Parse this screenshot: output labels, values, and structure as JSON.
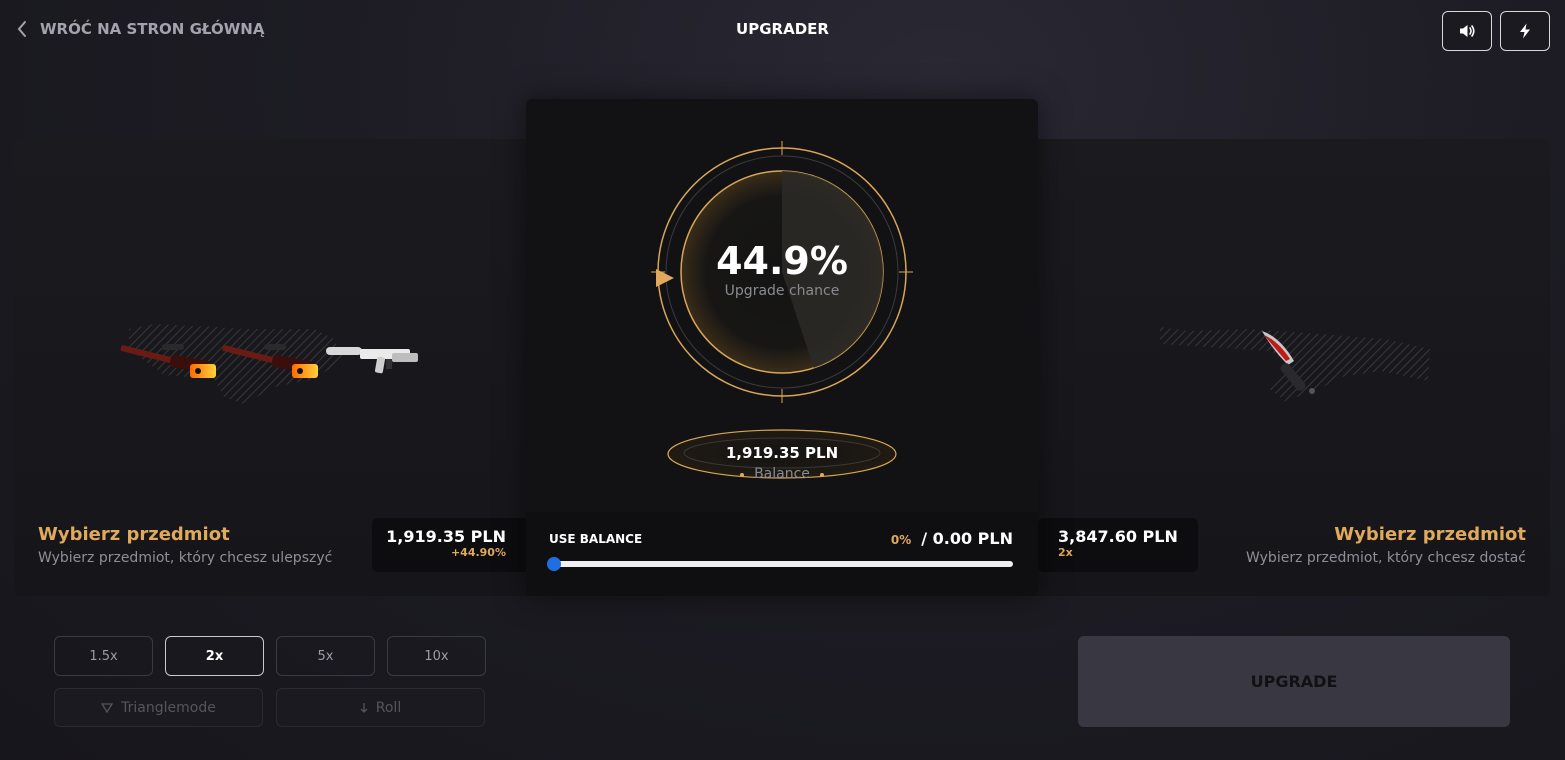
{
  "header": {
    "back_label": "WRÓĆ NA STRON GŁÓWNĄ",
    "title": "UPGRADER",
    "sound_icon": "speaker-icon",
    "fast_icon": "lightning-icon"
  },
  "left_panel": {
    "heading": "Wybierz przedmiot",
    "subtext": "Wybierz przedmiot, który chcesz ulepszyć",
    "price": "1,919.35 PLN",
    "change": "+44.90%",
    "items": [
      "awp-flame-rifle",
      "awp-flame-rifle",
      "m4a1s-white-rifle"
    ]
  },
  "center": {
    "chance": "44.9%",
    "chance_fraction": 0.449,
    "chance_label": "Upgrade chance",
    "balance_value": "1,919.35 PLN",
    "balance_label": "Balance",
    "use_balance": {
      "label": "USE BALANCE",
      "percent": "0%",
      "amount": "/ 0.00 PLN",
      "slider_value": 0
    }
  },
  "right_panel": {
    "heading": "Wybierz przedmiot",
    "subtext": "Wybierz przedmiot, który chcesz dostać",
    "price": "3,847.60 PLN",
    "multiplier": "2x",
    "item": "falchion-knife"
  },
  "multipliers": {
    "options": [
      "1.5x",
      "2x",
      "5x",
      "10x"
    ],
    "selected": "2x"
  },
  "modes": {
    "triangle_label": "Trianglemode",
    "roll_label": "Roll"
  },
  "upgrade_label": "UPGRADE",
  "colors": {
    "accent_gold": "#e0a95c",
    "slider_blue": "#1f6fe0",
    "background": "#1d1c24"
  }
}
